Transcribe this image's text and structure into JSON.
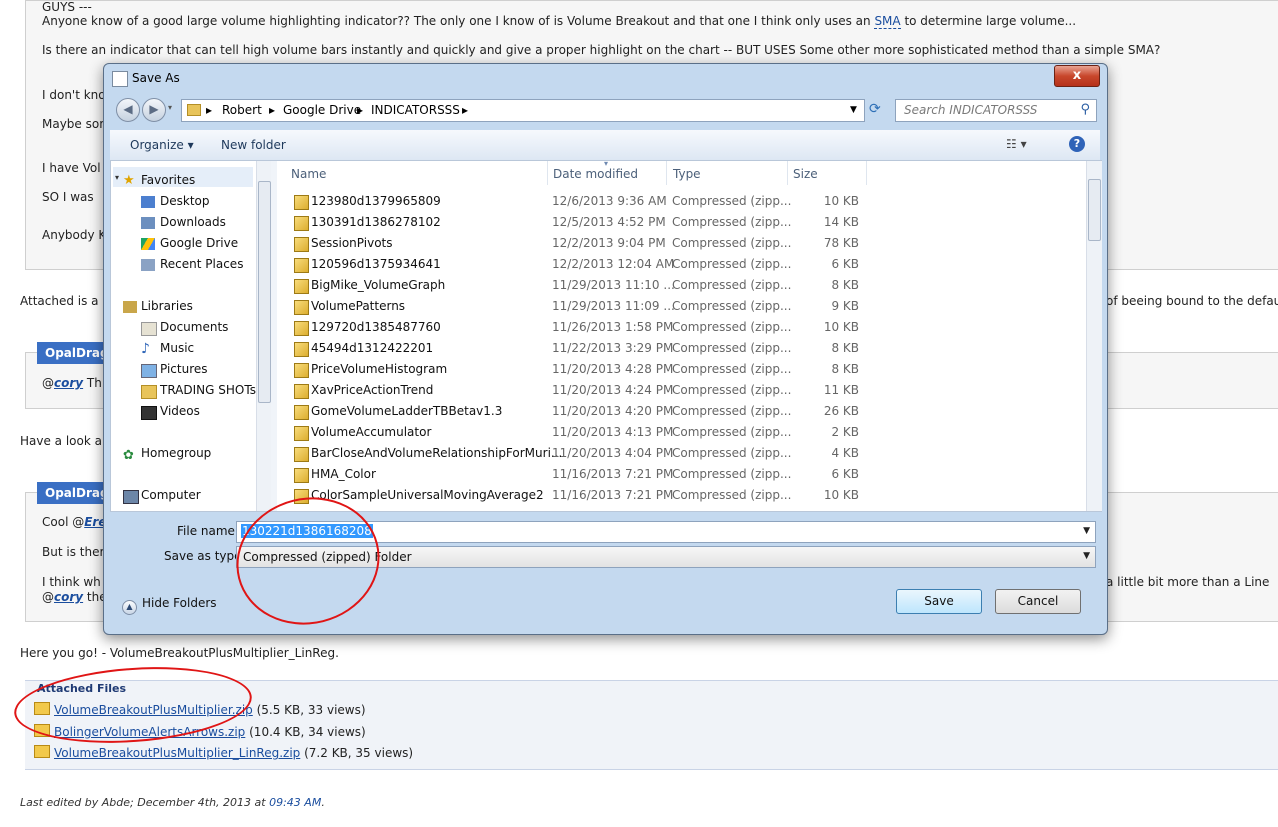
{
  "forum": {
    "line_guys": "GUYS ---",
    "line_q1_pre": "Anyone know of a good large volume highlighting indicator?? The only one I know of is Volume Breakout and that one I think only uses an ",
    "line_q1_sma": "SMA",
    "line_q1_post": " to determine large volume...",
    "line_q2": "Is there an indicator that can tell high volume bars instantly and quickly and give a proper highlight on the chart -- BUT USES Some other more sophisticated method than a simple SMA?",
    "line_dont": "I don't kno",
    "line_maybe": "Maybe som",
    "line_ihave": "I have Vol",
    "line_so": "SO I was",
    "line_anybody": "Anybody K",
    "attached_pre": "Attached is a",
    "attached_post": "of beeing bound to the defau",
    "poster1": "OpalDrag",
    "reply1_at": "@",
    "reply1_user": "cory",
    "reply1_rest": " Th",
    "have_look": "Have a look a",
    "poster2": "OpalDrag",
    "cool_pre": "Cool @",
    "cool_user": "Ere",
    "but_is": "But is ther",
    "think_pre": "I think wh",
    "think_post": "a little bit more than a Line",
    "cory2_at": "@",
    "cory2_user": "cory",
    "cory2_rest": " the",
    "here_you_go": "Here you go! - VolumeBreakoutPlusMultiplier_LinReg.",
    "attached_files_title": "Attached Files",
    "attachments": [
      {
        "name": "VolumeBreakoutPlusMultiplier.zip",
        "meta": " (5.5 KB, 33 views)"
      },
      {
        "name": "BolingerVolumeAlertsArrows.zip",
        "meta": " (10.4 KB, 34 views)"
      },
      {
        "name": "VolumeBreakoutPlusMultiplier_LinReg.zip",
        "meta": " (7.2 KB, 35 views)"
      }
    ],
    "edited_pre": "Last edited by Abde; December 4th, 2013 at ",
    "edited_time": "09:43 AM",
    "edited_post": "."
  },
  "dialog": {
    "title": "Save As",
    "close_label": "x",
    "breadcrumb": [
      "Robert",
      "Google Drive",
      "INDICATORSSS"
    ],
    "search_placeholder": "Search INDICATORSSS",
    "toolbar": {
      "organize": "Organize ▾",
      "new_folder": "New folder"
    },
    "nav": {
      "favorites": "Favorites",
      "desktop": "Desktop",
      "downloads": "Downloads",
      "google_drive": "Google Drive",
      "recent_places": "Recent Places",
      "libraries": "Libraries",
      "documents": "Documents",
      "music": "Music",
      "pictures": "Pictures",
      "trading": "TRADING SHOTs",
      "videos": "Videos",
      "homegroup": "Homegroup",
      "computer": "Computer"
    },
    "columns": {
      "name": "Name",
      "date": "Date modified",
      "type": "Type",
      "size": "Size"
    },
    "files": [
      {
        "name": "123980d1379965809",
        "date": "12/6/2013 9:36 AM",
        "type": "Compressed (zipp...",
        "size": "10 KB"
      },
      {
        "name": "130391d1386278102",
        "date": "12/5/2013 4:52 PM",
        "type": "Compressed (zipp...",
        "size": "14 KB"
      },
      {
        "name": "SessionPivots",
        "date": "12/2/2013 9:04 PM",
        "type": "Compressed (zipp...",
        "size": "78 KB"
      },
      {
        "name": "120596d1375934641",
        "date": "12/2/2013 12:04 AM",
        "type": "Compressed (zipp...",
        "size": "6 KB"
      },
      {
        "name": "BigMike_VolumeGraph",
        "date": "11/29/2013 11:10 ...",
        "type": "Compressed (zipp...",
        "size": "8 KB"
      },
      {
        "name": "VolumePatterns",
        "date": "11/29/2013 11:09 ...",
        "type": "Compressed (zipp...",
        "size": "9 KB"
      },
      {
        "name": "129720d1385487760",
        "date": "11/26/2013 1:58 PM",
        "type": "Compressed (zipp...",
        "size": "10 KB"
      },
      {
        "name": "45494d1312422201",
        "date": "11/22/2013 3:29 PM",
        "type": "Compressed (zipp...",
        "size": "8 KB"
      },
      {
        "name": "PriceVolumeHistogram",
        "date": "11/20/2013 4:28 PM",
        "type": "Compressed (zipp...",
        "size": "8 KB"
      },
      {
        "name": "XavPriceActionTrend",
        "date": "11/20/2013 4:24 PM",
        "type": "Compressed (zipp...",
        "size": "11 KB"
      },
      {
        "name": "GomeVolumeLadderTBBetav1.3",
        "date": "11/20/2013 4:20 PM",
        "type": "Compressed (zipp...",
        "size": "26 KB"
      },
      {
        "name": "VolumeAccumulator",
        "date": "11/20/2013 4:13 PM",
        "type": "Compressed (zipp...",
        "size": "2 KB"
      },
      {
        "name": "BarCloseAndVolumeRelationshipForMuri...",
        "date": "11/20/2013 4:04 PM",
        "type": "Compressed (zipp...",
        "size": "4 KB"
      },
      {
        "name": "HMA_Color",
        "date": "11/16/2013 7:21 PM",
        "type": "Compressed (zipp...",
        "size": "6 KB"
      },
      {
        "name": "ColorSampleUniversalMovingAverage2",
        "date": "11/16/2013 7:21 PM",
        "type": "Compressed (zipp...",
        "size": "10 KB"
      }
    ],
    "file_name_label": "File name:",
    "file_name_value": "130221d1386168208",
    "save_type_label": "Save as type:",
    "save_type_value": "Compressed (zipped) Folder",
    "hide_folders": "Hide Folders",
    "save": "Save",
    "cancel": "Cancel"
  },
  "colors": {
    "accent": "#3399ff",
    "annotation": "#e01515",
    "link": "#1a4d9e"
  }
}
